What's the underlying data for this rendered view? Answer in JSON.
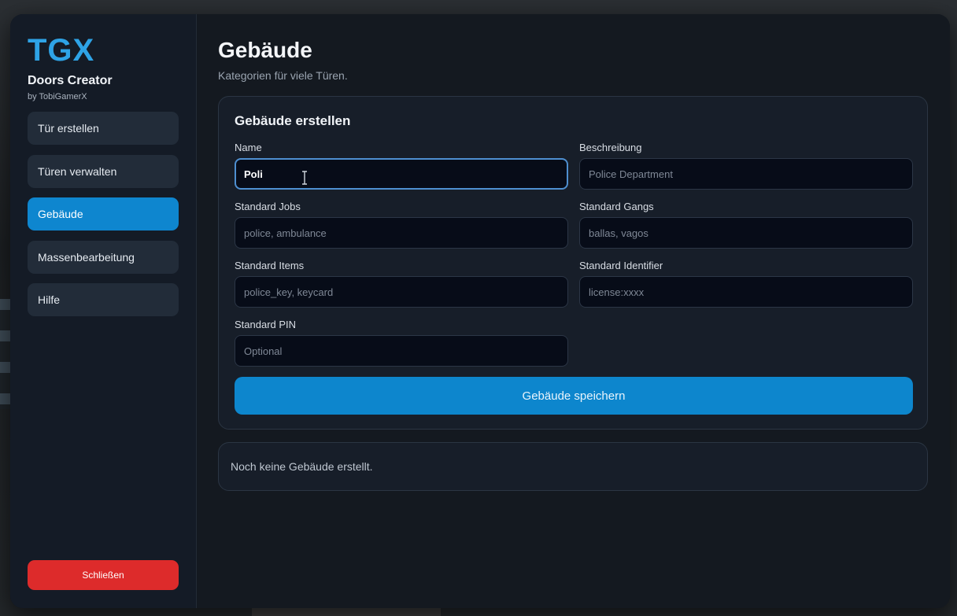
{
  "sidebar": {
    "logo": "TGX",
    "title": "Doors Creator",
    "subtitle": "by TobiGamerX",
    "items": [
      {
        "label": "Tür erstellen",
        "active": false
      },
      {
        "label": "Türen verwalten",
        "active": false
      },
      {
        "label": "Gebäude",
        "active": true
      },
      {
        "label": "Massenbearbeitung",
        "active": false
      },
      {
        "label": "Hilfe",
        "active": false
      }
    ],
    "close_label": "Schließen"
  },
  "main": {
    "title": "Gebäude",
    "subtitle": "Kategorien für viele Türen.",
    "form": {
      "title": "Gebäude erstellen",
      "fields": {
        "name": {
          "label": "Name",
          "value": "Poli",
          "placeholder": ""
        },
        "description": {
          "label": "Beschreibung",
          "value": "",
          "placeholder": "Police Department"
        },
        "jobs": {
          "label": "Standard Jobs",
          "value": "",
          "placeholder": "police, ambulance"
        },
        "gangs": {
          "label": "Standard Gangs",
          "value": "",
          "placeholder": "ballas, vagos"
        },
        "items": {
          "label": "Standard Items",
          "value": "",
          "placeholder": "police_key, keycard"
        },
        "identifier": {
          "label": "Standard Identifier",
          "value": "",
          "placeholder": "license:xxxx"
        },
        "pin": {
          "label": "Standard PIN",
          "value": "",
          "placeholder": "Optional"
        }
      },
      "save_label": "Gebäude speichern"
    },
    "empty_message": "Noch keine Gebäude erstellt."
  },
  "colors": {
    "accent": "#0e86cf",
    "logo": "#2ea3e6",
    "danger": "#dd2b2b",
    "panel": "#171e29",
    "input": "#070c18"
  },
  "icons": {
    "cursor": "text-cursor-icon"
  }
}
